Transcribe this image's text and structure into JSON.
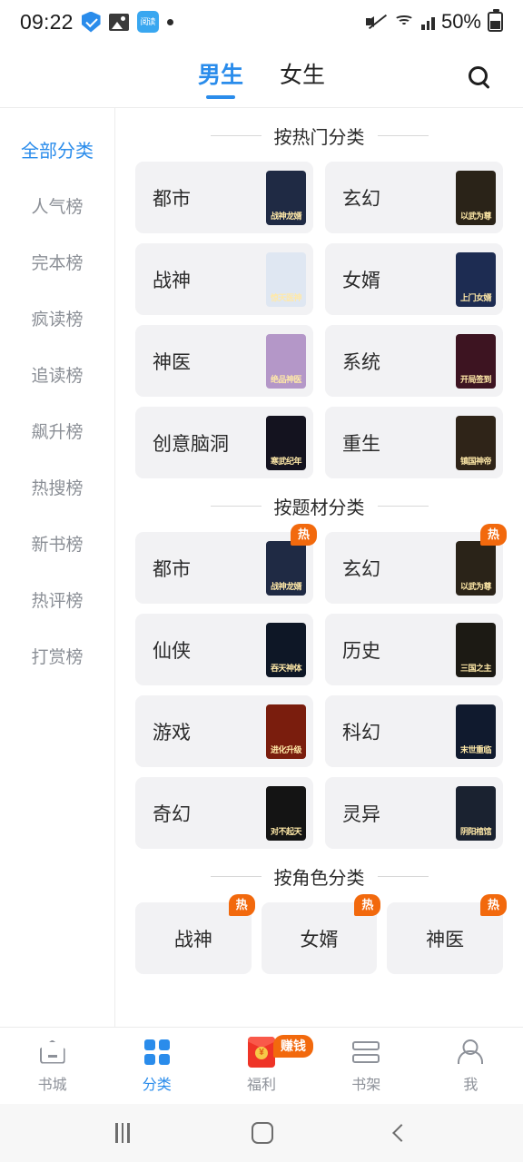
{
  "status_bar": {
    "time": "09:22",
    "battery_percent": "50%",
    "app_badge_label": "阅读",
    "icons": [
      "shield-check-icon",
      "image-icon",
      "app-badge-icon",
      "dot-icon",
      "mute-icon",
      "wifi-icon",
      "signal-icon",
      "battery-icon"
    ]
  },
  "header": {
    "tabs": [
      {
        "label": "男生",
        "active": true
      },
      {
        "label": "女生",
        "active": false
      }
    ],
    "search_icon": "search-icon"
  },
  "sidebar": {
    "items": [
      {
        "label": "全部分类",
        "active": true
      },
      {
        "label": "人气榜",
        "active": false
      },
      {
        "label": "完本榜",
        "active": false
      },
      {
        "label": "疯读榜",
        "active": false
      },
      {
        "label": "追读榜",
        "active": false
      },
      {
        "label": "飙升榜",
        "active": false
      },
      {
        "label": "热搜榜",
        "active": false
      },
      {
        "label": "新书榜",
        "active": false
      },
      {
        "label": "热评榜",
        "active": false
      },
      {
        "label": "打赏榜",
        "active": false
      }
    ]
  },
  "sections": [
    {
      "title": "按热门分类",
      "columns": 2,
      "cards": [
        {
          "label": "都市",
          "hot": false,
          "cover_title": "战神龙婿",
          "cover_color": "#1f2a44"
        },
        {
          "label": "玄幻",
          "hot": false,
          "cover_title": "以武为尊",
          "cover_color": "#2a2318"
        },
        {
          "label": "战神",
          "hot": false,
          "cover_title": "惊天医神",
          "cover_color": "#dfe7f2"
        },
        {
          "label": "女婿",
          "hot": false,
          "cover_title": "上门女婿",
          "cover_color": "#1d2c52"
        },
        {
          "label": "神医",
          "hot": false,
          "cover_title": "绝品神医",
          "cover_color": "#b497c8"
        },
        {
          "label": "系统",
          "hot": false,
          "cover_title": "开局签到",
          "cover_color": "#3d1421"
        },
        {
          "label": "创意脑洞",
          "hot": false,
          "cover_title": "寒武纪年",
          "cover_color": "#14131f"
        },
        {
          "label": "重生",
          "hot": false,
          "cover_title": "镇国神帝",
          "cover_color": "#2f2418"
        }
      ]
    },
    {
      "title": "按题材分类",
      "columns": 2,
      "cards": [
        {
          "label": "都市",
          "hot": true,
          "cover_title": "战神龙婿",
          "cover_color": "#1f2a44"
        },
        {
          "label": "玄幻",
          "hot": true,
          "cover_title": "以武为尊",
          "cover_color": "#2a2318"
        },
        {
          "label": "仙侠",
          "hot": false,
          "cover_title": "吞天神体",
          "cover_color": "#0e1726"
        },
        {
          "label": "历史",
          "hot": false,
          "cover_title": "三国之主",
          "cover_color": "#1c1a14"
        },
        {
          "label": "游戏",
          "hot": false,
          "cover_title": "进化升级",
          "cover_color": "#7a1d0d"
        },
        {
          "label": "科幻",
          "hot": false,
          "cover_title": "末世重临",
          "cover_color": "#101a2e"
        },
        {
          "label": "奇幻",
          "hot": false,
          "cover_title": "对不起天",
          "cover_color": "#141414"
        },
        {
          "label": "灵异",
          "hot": false,
          "cover_title": "阴阳棺馆",
          "cover_color": "#1a2230"
        }
      ]
    },
    {
      "title": "按角色分类",
      "columns": 3,
      "cards": [
        {
          "label": "战神",
          "hot": true
        },
        {
          "label": "女婿",
          "hot": true
        },
        {
          "label": "神医",
          "hot": true
        }
      ]
    }
  ],
  "hot_badge_label": "热",
  "bottom_nav": {
    "items": [
      {
        "label": "书城",
        "icon": "home-icon",
        "active": false
      },
      {
        "label": "分类",
        "icon": "grid-icon",
        "active": true
      },
      {
        "label": "福利",
        "icon": "red-envelope-icon",
        "active": false,
        "badge": "赚钱"
      },
      {
        "label": "书架",
        "icon": "bookshelf-icon",
        "active": false
      },
      {
        "label": "我",
        "icon": "person-icon",
        "active": false
      }
    ]
  },
  "android_nav": {
    "recents": "recents-icon",
    "home": "home-circle-icon",
    "back": "back-chevron-icon"
  },
  "colors": {
    "accent": "#2a8ceb",
    "hot_badge": "#f2690d",
    "card_bg": "#f2f2f4",
    "text": "#2b2b2b",
    "muted": "#8b8f96"
  }
}
